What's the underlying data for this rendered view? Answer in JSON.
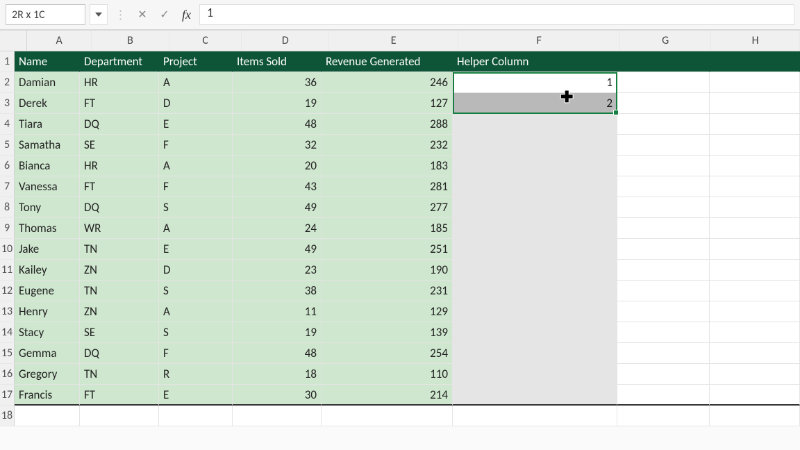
{
  "formula_bar": {
    "name_box": "2R x 1C",
    "fx_label": "fx",
    "value": "1"
  },
  "columns": [
    "A",
    "B",
    "C",
    "D",
    "E",
    "F",
    "G",
    "H"
  ],
  "row_numbers": [
    1,
    2,
    3,
    4,
    5,
    6,
    7,
    8,
    9,
    10,
    11,
    12,
    13,
    14,
    15,
    16,
    17,
    18
  ],
  "headers": {
    "A": "Name",
    "B": "Department",
    "C": "Project",
    "D": "Items Sold",
    "E": "Revenue Generated",
    "F": "Helper Column"
  },
  "rows": [
    {
      "name": "Damian",
      "dept": "HR",
      "proj": "A",
      "items": 36,
      "rev": 246,
      "helper": 1
    },
    {
      "name": "Derek",
      "dept": "FT",
      "proj": "D",
      "items": 19,
      "rev": 127,
      "helper": 2
    },
    {
      "name": "Tiara",
      "dept": "DQ",
      "proj": "E",
      "items": 48,
      "rev": 288,
      "helper": null
    },
    {
      "name": "Samatha",
      "dept": "SE",
      "proj": "F",
      "items": 32,
      "rev": 232,
      "helper": null
    },
    {
      "name": "Bianca",
      "dept": "HR",
      "proj": "A",
      "items": 20,
      "rev": 183,
      "helper": null
    },
    {
      "name": "Vanessa",
      "dept": "FT",
      "proj": "F",
      "items": 43,
      "rev": 281,
      "helper": null
    },
    {
      "name": "Tony",
      "dept": "DQ",
      "proj": "S",
      "items": 49,
      "rev": 277,
      "helper": null
    },
    {
      "name": "Thomas",
      "dept": "WR",
      "proj": "A",
      "items": 24,
      "rev": 185,
      "helper": null
    },
    {
      "name": "Jake",
      "dept": "TN",
      "proj": "E",
      "items": 49,
      "rev": 251,
      "helper": null
    },
    {
      "name": "Kailey",
      "dept": "ZN",
      "proj": "D",
      "items": 23,
      "rev": 190,
      "helper": null
    },
    {
      "name": "Eugene",
      "dept": "TN",
      "proj": "S",
      "items": 38,
      "rev": 231,
      "helper": null
    },
    {
      "name": "Henry",
      "dept": "ZN",
      "proj": "A",
      "items": 11,
      "rev": 129,
      "helper": null
    },
    {
      "name": "Stacy",
      "dept": "SE",
      "proj": "S",
      "items": 19,
      "rev": 139,
      "helper": null
    },
    {
      "name": "Gemma",
      "dept": "DQ",
      "proj": "F",
      "items": 48,
      "rev": 254,
      "helper": null
    },
    {
      "name": "Gregory",
      "dept": "TN",
      "proj": "R",
      "items": 18,
      "rev": 110,
      "helper": null
    },
    {
      "name": "Francis",
      "dept": "FT",
      "proj": "E",
      "items": 30,
      "rev": 214,
      "helper": null
    }
  ]
}
